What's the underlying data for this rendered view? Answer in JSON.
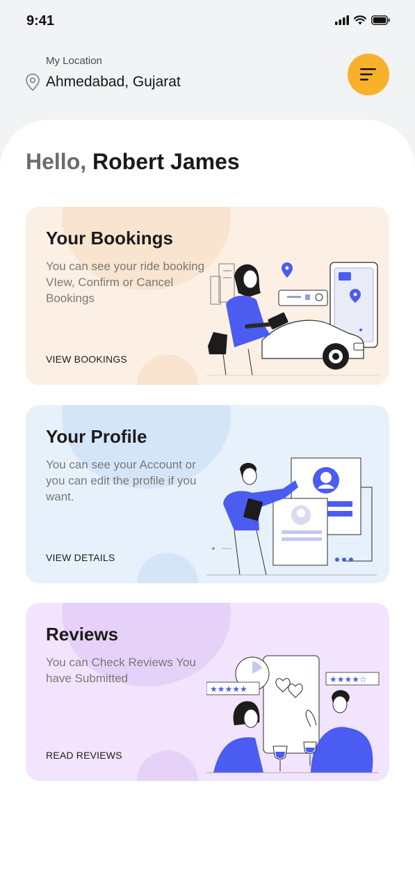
{
  "status_bar": {
    "time": "9:41"
  },
  "header": {
    "location_label": "My Location",
    "location_value": "Ahmedabad, Gujarat"
  },
  "greeting": {
    "hello": "Hello,",
    "name": "Robert James"
  },
  "cards": [
    {
      "title": "Your Bookings",
      "description": "You can see your ride booking VIew, Confirm or Cancel Bookings",
      "link": "VIEW BOOKINGS"
    },
    {
      "title": "Your Profile",
      "description": "You can see your Account or you can edit the profile if you want.",
      "link": "VIEW DETAILS"
    },
    {
      "title": "Reviews",
      "description": "You can Check Reviews You have Submitted",
      "link": "READ REVIEWS"
    }
  ],
  "colors": {
    "accent": "#f9b12c",
    "illustration_blue": "#4b5cf0",
    "bookings_bg": "#fcf0e5",
    "profile_bg": "#e6f1fc",
    "reviews_bg": "#f1e4fc"
  },
  "icons": [
    "signal-icon",
    "wifi-icon",
    "battery-icon",
    "location-pin-icon",
    "menu-icon"
  ]
}
